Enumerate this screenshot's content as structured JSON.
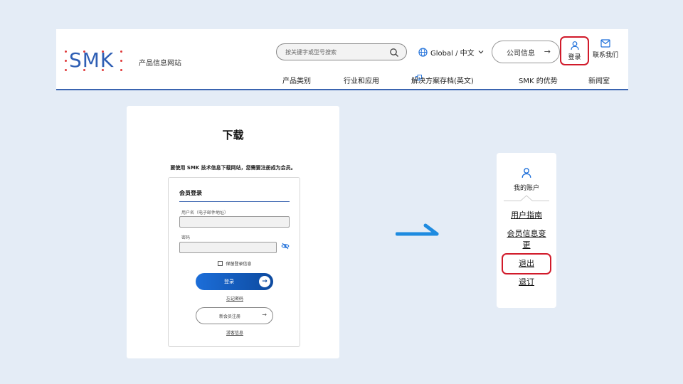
{
  "header": {
    "logo_text": "SMK",
    "site_name": "产品信息网站",
    "search_placeholder": "按关键字或型号搜索",
    "language": "Global / 中文",
    "company_button": "公司信息",
    "login_label": "登录",
    "contact_label": "联系我们",
    "nav": [
      "产品类别",
      "行业和应用",
      "解决方案存档(英文)",
      "SMK 的优势",
      "新闻室"
    ]
  },
  "download": {
    "title": "下载",
    "note": "要使用 SMK 技术信息下载网站，您需要注册成为会员。",
    "member_title": "会员登录",
    "username_label": "用户名（电子邮件地址）",
    "password_label": "密码",
    "remember_label": "保留登录信息",
    "login_button": "登录",
    "forgot_link": "忘记密码",
    "register_button": "新会员注册",
    "guest_link": "游客信息"
  },
  "account_panel": {
    "title": "我的账户",
    "items": [
      "用户指南",
      "会员信息变",
      "更",
      "退出",
      "退订"
    ]
  },
  "colors": {
    "accent": "#1c6ed9",
    "highlight": "#d11a2a",
    "background": "#e4ecf6"
  }
}
